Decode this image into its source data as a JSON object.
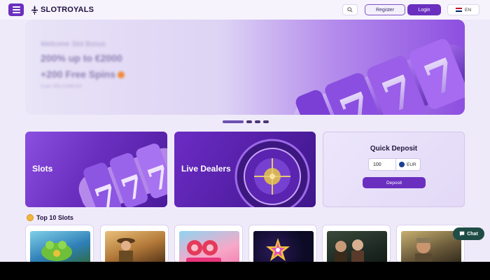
{
  "header": {
    "brand": "SLOTROYALS",
    "register_label": "Register",
    "login_label": "Login",
    "language": "EN",
    "icons": [
      "menu-icon",
      "search-icon",
      "uk-flag-icon"
    ]
  },
  "hero": {
    "line1": "Welcome Slot Bonus",
    "line2": "200% up to €2000",
    "line3": "+200 Free Spins",
    "line4": "Code: WELCOME200",
    "slides": 4,
    "active_slide": 1
  },
  "categories": [
    {
      "label": "Slots"
    },
    {
      "label": "Live Dealers"
    }
  ],
  "quick_deposit": {
    "title": "Quick Deposit",
    "amount": "100",
    "currency": "EUR",
    "button_label": "Deposit"
  },
  "top10": {
    "title": "Top 10 Slots",
    "cards": 6
  },
  "chat": {
    "label": "Chat"
  },
  "colors": {
    "accent": "#6b2fc0",
    "chat": "#1f4d46",
    "background": "#efeaf9"
  }
}
